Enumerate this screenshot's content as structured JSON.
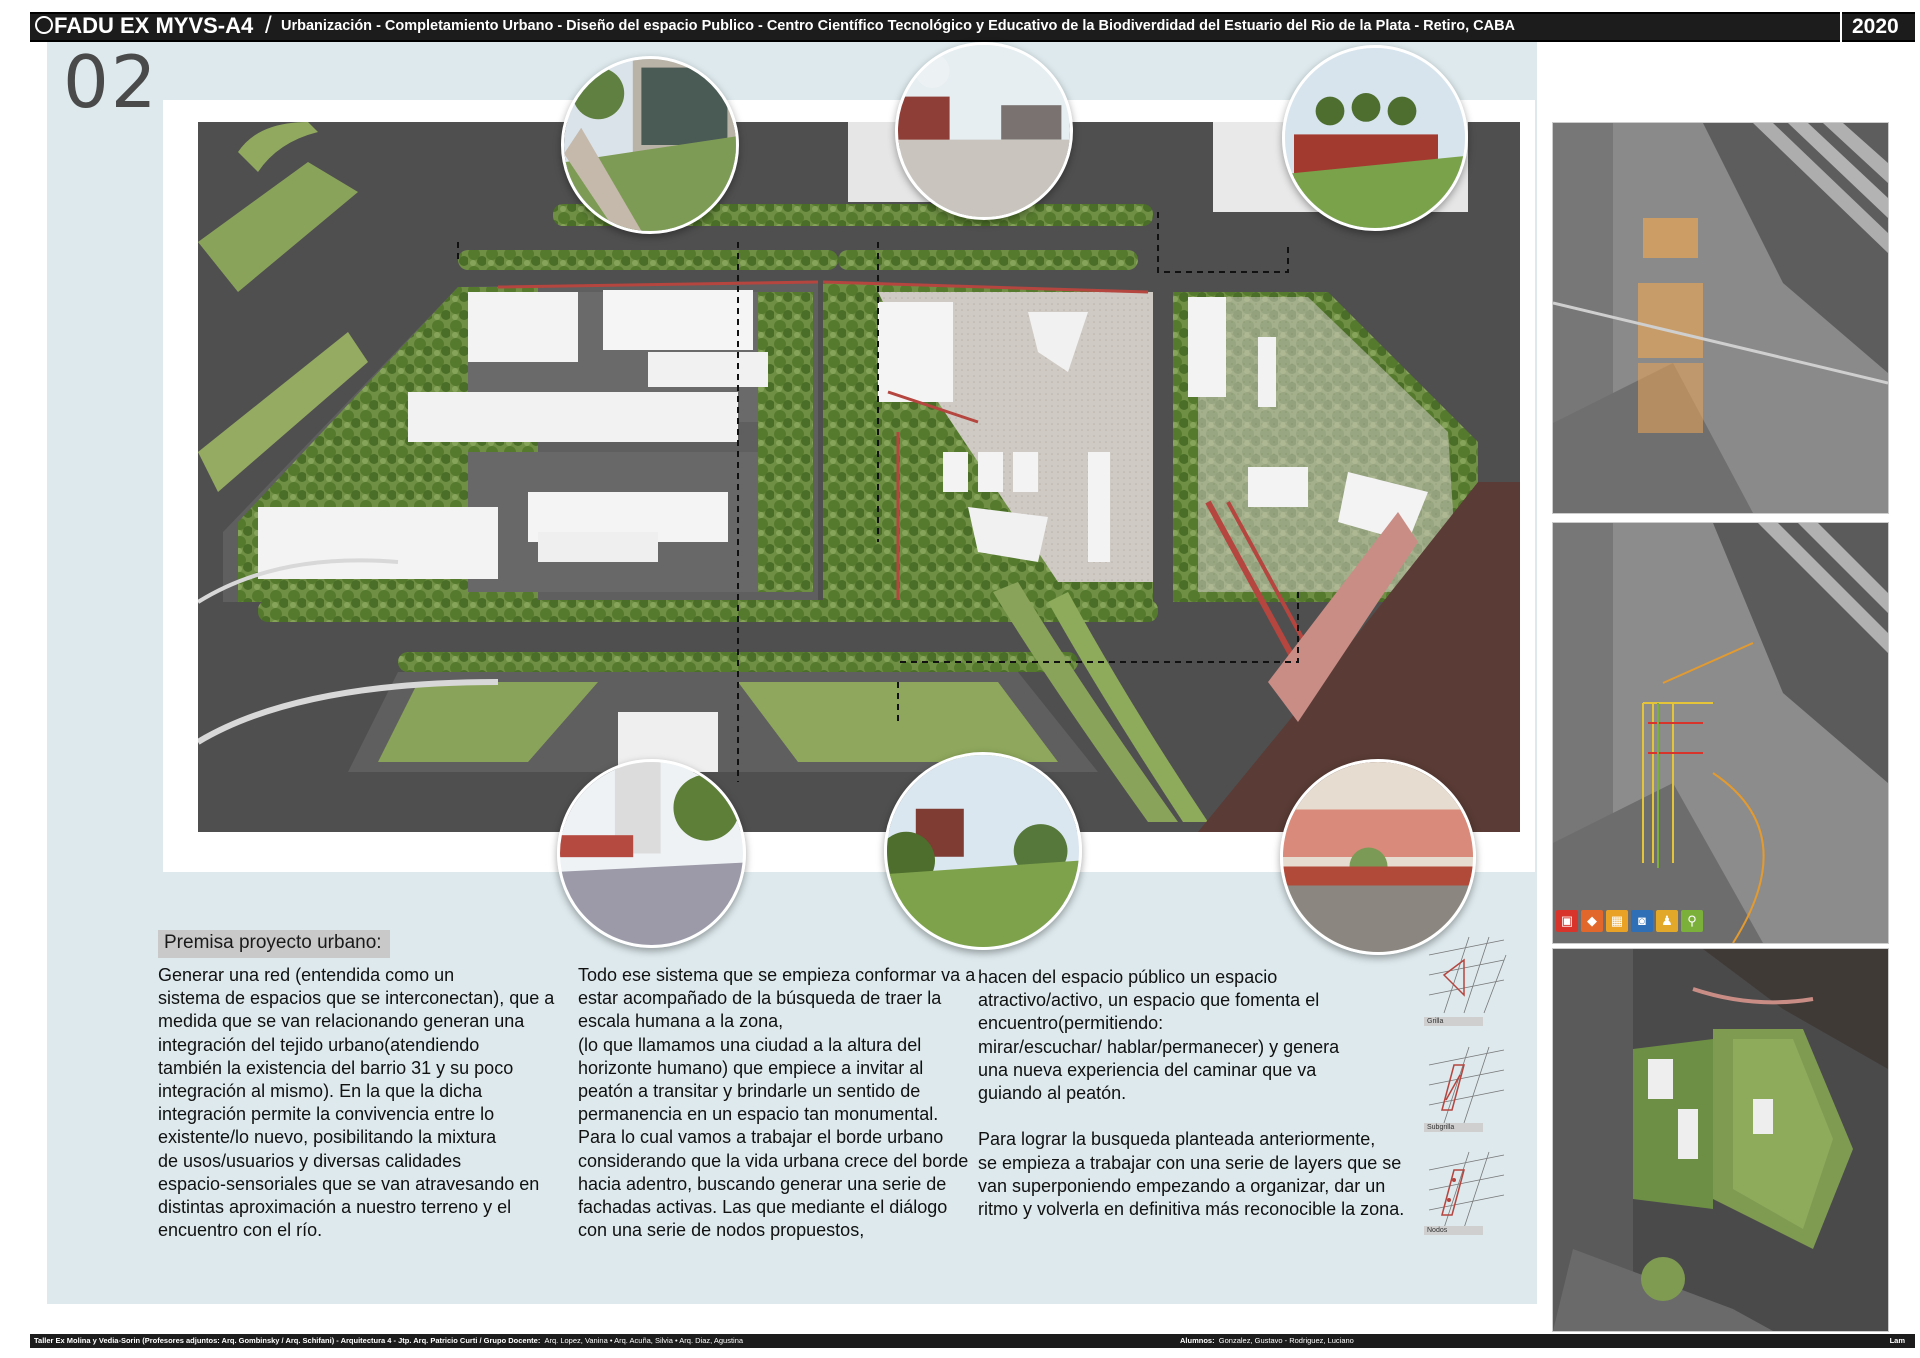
{
  "header": {
    "title": "FADU EX MYVS-A4",
    "subtitle": "Urbanización - Completamiento Urbano - Diseño del espacio Publico - Centro Científico Tecnológico y Educativo de la Biodiverdidad del Estuario del Rio de la Plata   - Retiro, CABA",
    "year": "2020",
    "seal_icon": "university-seal-icon"
  },
  "page_number": "02",
  "premise": {
    "title": "Premisa proyecto urbano:",
    "col1": "Generar una red (entendida como un\nsistema de espacios que se interconectan), que a\nmedida que se van relacionando generan una\nintegración del tejido urbano(atendiendo\n también la existencia del barrio 31 y su poco\nintegración al mismo). En la que  la dicha\nintegración permite la convivencia entre lo\nexistente/lo nuevo, posibilitando la mixtura\nde usos/usuarios y diversas calidades\nespacio-sensoriales que se van atravesando en\ndistintas aproximación a nuestro terreno y el\nencuentro con el río.",
    "col2": "Todo ese sistema que se empieza conformar va a\nestar acompañado de la búsqueda de traer la\nescala humana a la zona,\n(lo que llamamos una ciudad a la altura del\nhorizonte humano) que empiece a invitar al\npeatón a transitar y brindarle un sentido de\npermanencia en un espacio tan monumental.\nPara lo cual vamos a trabajar el borde urbano\nconsiderando que la vida urbana crece del borde\nhacia adentro, buscando generar una serie de\nfachadas activas. Las que mediante el diálogo\ncon una serie de nodos propuestos,",
    "col3": "hacen del espacio público un espacio\natractivo/activo, un espacio que fomenta el\nencuentro(permitiendo:\nmirar/escuchar/ hablar/permanecer) y  genera\nuna nueva experiencia del caminar que va\nguiando al peatón.\n\nPara lograr la busqueda planteada anteriormente,\nse empieza a trabajar con una serie de layers que se\nvan superponiendo  empezando a organizar, dar un\nritmo y volverla en definitiva más reconocible la zona."
  },
  "layers": [
    {
      "label": "Grilla"
    },
    {
      "label": "Subgrilla"
    },
    {
      "label": "Nodos"
    }
  ],
  "legend_icons": [
    {
      "name": "bus-icon",
      "glyph": "▣",
      "color": "#d9342b"
    },
    {
      "name": "car-icon",
      "glyph": "◆",
      "color": "#e2672a"
    },
    {
      "name": "train-icon",
      "glyph": "▦",
      "color": "#e9a126"
    },
    {
      "name": "subway-icon",
      "glyph": "◙",
      "color": "#2f6fb5"
    },
    {
      "name": "pedestrian-icon",
      "glyph": "♟",
      "color": "#e2a82a"
    },
    {
      "name": "bicycle-icon",
      "glyph": "⚲",
      "color": "#7bb03a"
    }
  ],
  "colors": {
    "panel": "#dde9ed",
    "header": "#1c1c1c",
    "accent_red": "#b5453f",
    "highlight_orange": "#e2a45a",
    "grass": "#7f9b52",
    "trees": "#4f7a2e"
  },
  "footer": {
    "left_bold": "Taller Ex Molina y Vedia-Sorin (Profesores adjuntos:  Arq. Gombinsky / Arq. Schifani) - Arquitectura 4 - Jtp. Arq. Patricio Curti / Grupo Docente:",
    "left_small": "Arq. Lopez, Vanina • Arq. Acuña, Silvia • Arq. Diaz, Agustina",
    "mid_bold": "Alumnos:",
    "mid_small": "Gonzalez, Gustavo - Rodriguez, Luciano",
    "right": "Lam"
  }
}
